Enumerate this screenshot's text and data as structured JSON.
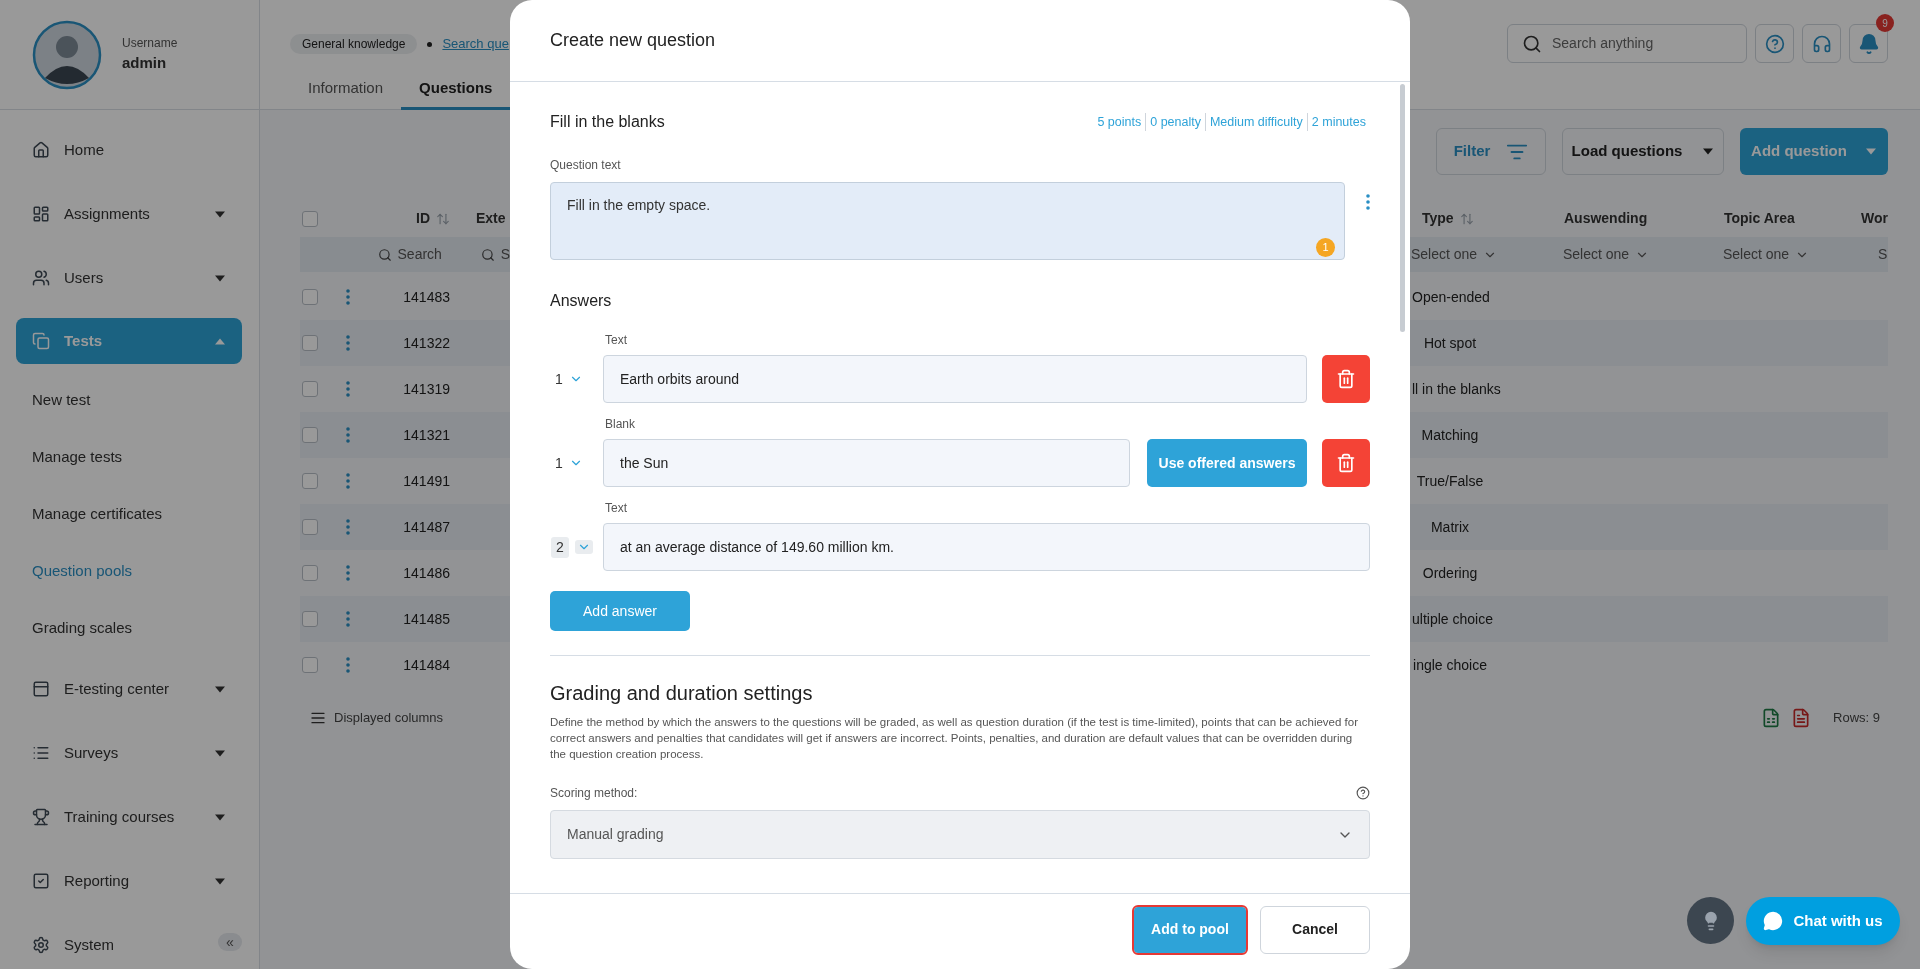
{
  "sidebar": {
    "user": {
      "label": "Username",
      "name": "admin"
    },
    "collapse": "«",
    "nav": [
      {
        "label": "Home",
        "kind": "link",
        "selected": false
      },
      {
        "label": "Assignments",
        "kind": "group",
        "expanded": false,
        "selected": false
      },
      {
        "label": "Users",
        "kind": "group",
        "expanded": false,
        "selected": false
      },
      {
        "label": "Tests",
        "kind": "group",
        "expanded": true,
        "selected": true,
        "children": [
          {
            "label": "New test",
            "selected": false
          },
          {
            "label": "Manage tests",
            "selected": false
          },
          {
            "label": "Manage certificates",
            "selected": false
          },
          {
            "label": "Question pools",
            "selected": true
          },
          {
            "label": "Grading scales",
            "selected": false
          }
        ]
      },
      {
        "label": "E-testing center",
        "kind": "group",
        "expanded": false,
        "selected": false
      },
      {
        "label": "Surveys",
        "kind": "group",
        "expanded": false,
        "selected": false
      },
      {
        "label": "Training courses",
        "kind": "group",
        "expanded": false,
        "selected": false
      },
      {
        "label": "Reporting",
        "kind": "group",
        "expanded": false,
        "selected": false
      },
      {
        "label": "System",
        "kind": "link",
        "selected": false
      }
    ]
  },
  "header": {
    "tag": "General knowledge",
    "link": "Search que",
    "tabs": [
      {
        "label": "Information",
        "selected": false
      },
      {
        "label": "Questions",
        "selected": true
      }
    ],
    "search": {
      "placeholder": "Search anything"
    },
    "notifications": "9"
  },
  "toolbar": {
    "filter": "Filter",
    "load": "Load questions",
    "add": "Add question"
  },
  "table": {
    "select_all_checked": false,
    "left_columns": [
      {
        "label": "ID",
        "sortable": true
      },
      {
        "label": "Exte",
        "sortable": false
      }
    ],
    "left_filters": [
      {
        "kind": "search",
        "text": "Search"
      },
      {
        "kind": "search",
        "text": "S"
      }
    ],
    "right_columns": [
      {
        "label": "Type",
        "sortable": true
      },
      {
        "label": "Auswending",
        "sortable": false
      },
      {
        "label": "Topic Area",
        "sortable": false
      },
      {
        "label": "Wor",
        "sortable": false
      }
    ],
    "right_filters": [
      {
        "kind": "select",
        "text": "Select one"
      },
      {
        "kind": "select",
        "text": "Select one"
      },
      {
        "kind": "select",
        "text": "Select one"
      },
      {
        "kind": "partial",
        "text": "S"
      }
    ],
    "rows": [
      {
        "id": "141483",
        "type": "Open-ended",
        "checked": false
      },
      {
        "id": "141322",
        "type": "Hot spot",
        "checked": false
      },
      {
        "id": "141319",
        "type": "ll in the blanks",
        "checked": false
      },
      {
        "id": "141321",
        "type": "Matching",
        "checked": false
      },
      {
        "id": "141491",
        "type": "True/False",
        "checked": false
      },
      {
        "id": "141487",
        "type": "Matrix",
        "checked": false
      },
      {
        "id": "141486",
        "type": "Ordering",
        "checked": false
      },
      {
        "id": "141485",
        "type": "ultiple choice",
        "checked": false
      },
      {
        "id": "141484",
        "type": "ingle choice",
        "checked": false
      }
    ],
    "columns_button": "Displayed columns",
    "rows_count": "Rows: 9"
  },
  "modal": {
    "title": "Create new question",
    "question_type": "Fill in the blanks",
    "meta": [
      "5 points",
      "0 penalty",
      "Medium difficulty",
      "2 minutes"
    ],
    "question_label": "Question text",
    "question_text": "Fill in the empty space.",
    "question_badge": "1",
    "answers_title": "Answers",
    "answers": [
      {
        "kind": "text",
        "label": "Text",
        "number": "1",
        "value": "Earth orbits around",
        "highlighted": false,
        "deletable": true
      },
      {
        "kind": "blank",
        "label": "Blank",
        "number": "1",
        "value": "the Sun",
        "action": "Use offered answers",
        "highlighted": false,
        "deletable": true
      },
      {
        "kind": "text",
        "label": "Text",
        "number": "2",
        "value": "at an average distance of 149.60 million km.",
        "highlighted": true,
        "deletable": false
      }
    ],
    "add_answer": "Add answer",
    "grading": {
      "title": "Grading and duration settings",
      "description": "Define the method by which the answers to the questions will be graded, as well as question duration (if the test is time-limited), points that can be achieved for correct answers and penalties that candidates will get if answers are incorrect. Points, penalties, and duration are default values that can be overridden during the question creation process.",
      "scoring_label": "Scoring method:",
      "scoring_value": "Manual grading"
    },
    "footer": {
      "primary": "Add to pool",
      "primary_focused": true,
      "cancel": "Cancel"
    }
  },
  "chat": {
    "label": "Chat with us"
  }
}
